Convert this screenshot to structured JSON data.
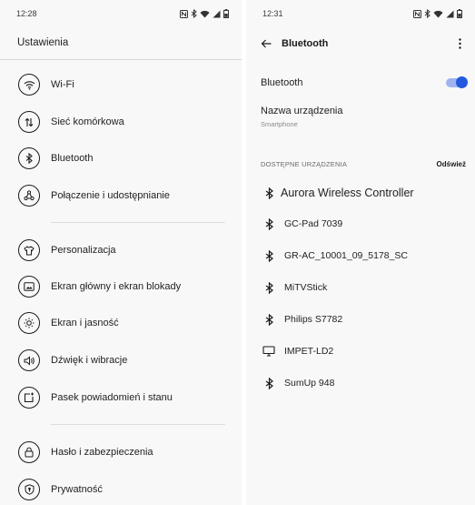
{
  "left": {
    "time": "12:28",
    "title": "Ustawienia",
    "items": [
      {
        "label": "Wi-Fi",
        "icon": "wifi-icon"
      },
      {
        "label": "Sieć komórkowa",
        "icon": "mobile-data-icon"
      },
      {
        "label": "Bluetooth",
        "icon": "bluetooth-icon"
      },
      {
        "label": "Połączenie i udostępnianie",
        "icon": "share-icon"
      },
      {
        "label": "Personalizacja",
        "icon": "shirt-icon"
      },
      {
        "label": "Ekran główny i ekran blokady",
        "icon": "home-screen-icon"
      },
      {
        "label": "Ekran i jasność",
        "icon": "brightness-icon"
      },
      {
        "label": "Dźwięk i wibracje",
        "icon": "volume-icon"
      },
      {
        "label": "Pasek powiadomień i stanu",
        "icon": "notification-icon"
      },
      {
        "label": "Hasło i zabezpieczenia",
        "icon": "lock-icon"
      },
      {
        "label": "Prywatność",
        "icon": "privacy-icon"
      }
    ]
  },
  "right": {
    "time": "12:31",
    "title": "Bluetooth",
    "bluetooth_label": "Bluetooth",
    "bluetooth_on": true,
    "device_name_label": "Nazwa urządzenia",
    "device_name_value": "Smartphone",
    "section_header": "DOSTĘPNE URZĄDZENIA",
    "refresh_label": "Odśwież",
    "devices": [
      {
        "name": "Aurora Wireless Controller",
        "icon": "bluetooth-icon"
      },
      {
        "name": "GC-Pad 7039",
        "icon": "bluetooth-icon"
      },
      {
        "name": "GR-AC_10001_09_5178_SC",
        "icon": "bluetooth-icon"
      },
      {
        "name": "MiTVStick",
        "icon": "bluetooth-icon"
      },
      {
        "name": "Philips S7782",
        "icon": "bluetooth-icon"
      },
      {
        "name": "IMPET-LD2",
        "icon": "computer-icon"
      },
      {
        "name": "SumUp 948",
        "icon": "bluetooth-icon"
      }
    ]
  },
  "colors": {
    "accent": "#2459df",
    "switch_track": "#9db4ef",
    "panel_bg": "#f8f8f8"
  }
}
